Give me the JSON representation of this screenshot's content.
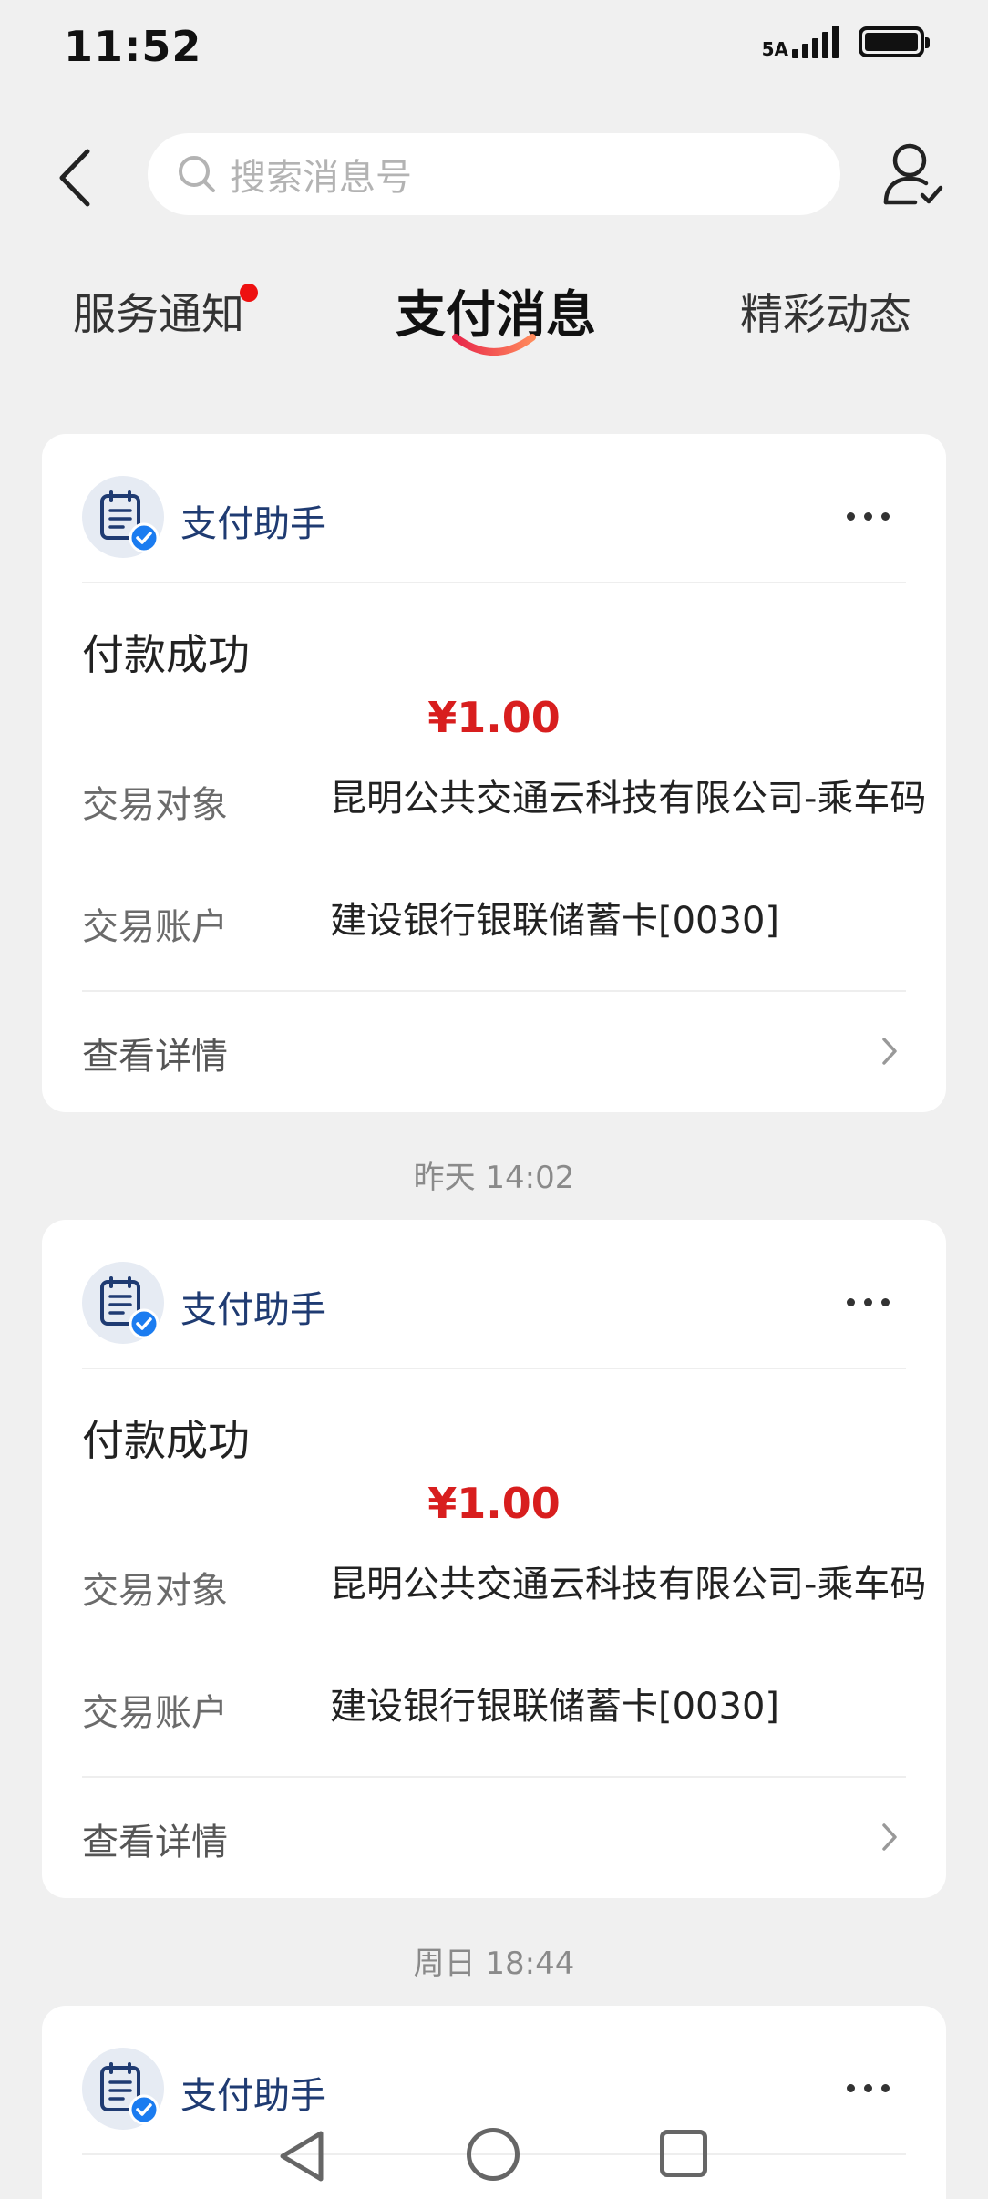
{
  "status_bar": {
    "time": "11:52",
    "network_label": "5A"
  },
  "search": {
    "placeholder": "搜索消息号"
  },
  "tabs": [
    {
      "label": "服务通知",
      "unread": true
    },
    {
      "label": "支付消息",
      "active": true
    },
    {
      "label": "精彩动态"
    }
  ],
  "colors": {
    "accent": "#d81e1e",
    "sender": "#1f3b72",
    "verified_badge": "#1b7cf0"
  },
  "icons": {
    "back": "chevron-left-icon",
    "search": "search-icon",
    "contacts": "user-check-icon",
    "avatar": "clipboard-verified-icon",
    "more": "more-horizontal-icon",
    "details": "chevron-right-icon"
  },
  "messages": [
    {
      "sender": "支付助手",
      "title": "付款成功",
      "amount": "¥1.00",
      "rows": [
        {
          "label": "交易对象",
          "value": "昆明公共交通云科技有限公司-乘车码"
        },
        {
          "label": "交易账户",
          "value": "建设银行银联储蓄卡[0030]"
        }
      ],
      "details_label": "查看详情"
    },
    {
      "timestamp": "昨天 14:02",
      "sender": "支付助手",
      "title": "付款成功",
      "amount": "¥1.00",
      "rows": [
        {
          "label": "交易对象",
          "value": "昆明公共交通云科技有限公司-乘车码"
        },
        {
          "label": "交易账户",
          "value": "建设银行银联储蓄卡[0030]"
        }
      ],
      "details_label": "查看详情"
    },
    {
      "timestamp": "周日 18:44",
      "sender": "支付助手"
    }
  ]
}
